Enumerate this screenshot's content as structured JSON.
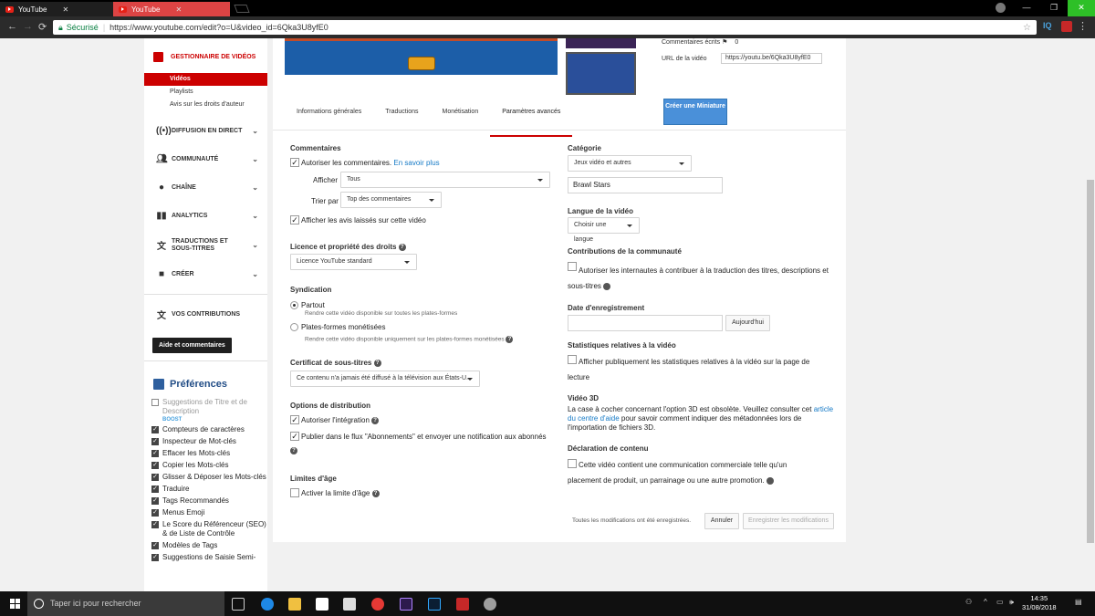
{
  "browser": {
    "tabs": [
      {
        "title": "YouTube"
      },
      {
        "title": "YouTube"
      }
    ],
    "secure_label": "Sécurisé",
    "url": "https://www.youtube.com/edit?o=U&video_id=6Qka3U8yfE0",
    "ext_iq": "IQ"
  },
  "sidebar": {
    "header": "GESTIONNAIRE DE VIDÉOS",
    "sub_items": [
      {
        "label": "Vidéos"
      },
      {
        "label": "Playlists"
      },
      {
        "label": "Avis sur les droits d'auteur"
      }
    ],
    "sections": [
      {
        "label": "DIFFUSION EN DIRECT",
        "icon": "live-icon"
      },
      {
        "label": "COMMUNAUTÉ",
        "icon": "community-icon"
      },
      {
        "label": "CHAÎNE",
        "icon": "channel-icon"
      },
      {
        "label": "ANALYTICS",
        "icon": "analytics-icon"
      },
      {
        "label": "TRADUCTIONS ET SOUS-TITRES",
        "icon": "translate-icon"
      },
      {
        "label": "CRÉER",
        "icon": "create-icon"
      }
    ],
    "contributions": "VOS CONTRIBUTIONS",
    "help_button": "Aide et commentaires",
    "preferences_title": "Préférences",
    "pref_items": [
      {
        "label": "Suggestions de Titre et de Description",
        "checked": false
      },
      {
        "label": "Compteurs de caractères",
        "checked": true
      },
      {
        "label": "Inspecteur de Mot-clés",
        "checked": true
      },
      {
        "label": "Effacer les Mots-clés",
        "checked": true
      },
      {
        "label": "Copier les Mots-clés",
        "checked": true
      },
      {
        "label": "Glisser & Déposer les Mots-clés",
        "checked": true
      },
      {
        "label": "Traduire",
        "checked": true
      },
      {
        "label": "Tags Recommandés",
        "checked": true
      },
      {
        "label": "Menus Emoji",
        "checked": true
      },
      {
        "label": "Le Score du Référenceur (SEO) & de Liste de Contrôle",
        "checked": true
      },
      {
        "label": "Modèles de Tags",
        "checked": true
      },
      {
        "label": "Suggestions de Saisie Semi-",
        "checked": true
      }
    ],
    "boost": "BOOST"
  },
  "video_meta": {
    "comments_label": "Commentaires écrits",
    "comments_count": "0",
    "url_label": "URL de la vidéo",
    "url_value": "https://youtu.be/6Qka3U8yfE0"
  },
  "tabs": [
    {
      "label": "Informations générales"
    },
    {
      "label": "Traductions"
    },
    {
      "label": "Monétisation"
    },
    {
      "label": "Paramètres avancés"
    }
  ],
  "create_miniature": "Créer une Miniature",
  "left": {
    "comments_title": "Commentaires",
    "allow_comments": "Autoriser les commentaires.",
    "learn_more": "En savoir plus",
    "afficher_label": "Afficher",
    "afficher_value": "Tous",
    "trier_label": "Trier par",
    "trier_value": "Top des commentaires",
    "show_ratings": "Afficher les avis laissés sur cette vidéo",
    "license_title": "Licence et propriété des droits",
    "license_value": "Licence YouTube standard",
    "syndication_title": "Syndication",
    "partout": "Partout",
    "partout_desc": "Rendre cette vidéo disponible sur toutes les plates-formes",
    "monetized": "Plates-formes monétisées",
    "monetized_desc": "Rendre cette vidéo disponible uniquement sur les plates-formes monétisées",
    "caption_title": "Certificat de sous-titres",
    "caption_value": "Ce contenu n'a jamais été diffusé à la télévision aux États-U...",
    "distribution_title": "Options de distribution",
    "allow_embed": "Autoriser l'intégration",
    "publish_feed": "Publier dans le flux \"Abonnements\" et envoyer une notification aux abonnés",
    "age_title": "Limites d'âge",
    "age_enable": "Activer la limite d'âge"
  },
  "right": {
    "category_title": "Catégorie",
    "category_value": "Jeux vidéo et autres",
    "game_value": "Brawl Stars",
    "language_title": "Langue de la vidéo",
    "language_value": "Choisir une langue",
    "community_title": "Contributions de la communauté",
    "community_text": "Autoriser les internautes à contribuer à la traduction des titres, descriptions et sous-titres",
    "recording_title": "Date d'enregistrement",
    "today_button": "Aujourd'hui",
    "stats_title": "Statistiques relatives à la vidéo",
    "stats_text": "Afficher publiquement les statistiques relatives à la vidéo sur la page de lecture",
    "video3d_title": "Vidéo 3D",
    "video3d_text1": "La case à cocher concernant l'option 3D est obsolète. Veuillez consulter cet",
    "video3d_link": "article du centre d'aide",
    "video3d_text2": "pour savoir comment indiquer des métadonnées lors de l'importation de fichiers 3D.",
    "content_title": "Déclaration de contenu",
    "content_text": "Cette vidéo contient une communication commerciale telle qu'un placement de produit, un parrainage ou une autre promotion."
  },
  "footer": {
    "saved_text": "Toutes les modifications ont été enregistrées.",
    "cancel": "Annuler",
    "save": "Enregistrer les modifications"
  },
  "taskbar": {
    "search_placeholder": "Taper ici pour rechercher",
    "time": "14:35",
    "date": "31/08/2018"
  }
}
